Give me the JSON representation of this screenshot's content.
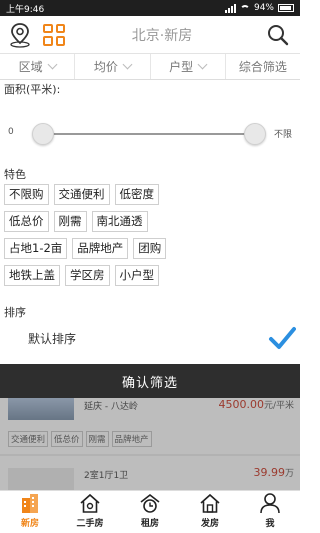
{
  "status_bar": {
    "time": "上午9:46",
    "battery": "94%"
  },
  "header": {
    "title": "北京·新房"
  },
  "filter_tabs": [
    {
      "label": "区域"
    },
    {
      "label": "均价"
    },
    {
      "label": "户型"
    },
    {
      "label": "综合筛选"
    }
  ],
  "area": {
    "label": "面积(平米):",
    "min": "0",
    "max": "不限"
  },
  "features": {
    "label": "特色",
    "tags": [
      "不限购",
      "交通便利",
      "低密度",
      "低总价",
      "刚需",
      "南北通透",
      "占地1-2亩",
      "品牌地产",
      "团购",
      "地铁上盖",
      "学区房",
      "小户型"
    ]
  },
  "sort": {
    "label": "排序",
    "option": "默认排序"
  },
  "confirm": {
    "label": "确认筛选"
  },
  "listing": {
    "item1": {
      "subtitle": "延庆 - 八达岭",
      "price": "4500.00",
      "price_unit": "元/平米",
      "tags": [
        "交通便利",
        "低总价",
        "刚需",
        "品牌地产"
      ]
    },
    "item2": {
      "layout": "2室1厅1卫",
      "price": "39.99",
      "price_unit": "万"
    }
  },
  "bottom_nav": [
    {
      "label": "新房"
    },
    {
      "label": "二手房"
    },
    {
      "label": "租房"
    },
    {
      "label": "发房"
    },
    {
      "label": "我"
    }
  ],
  "colors": {
    "accent": "#f08519",
    "confirm_bar": "#2e2e2e",
    "check": "#2b8fe0"
  }
}
